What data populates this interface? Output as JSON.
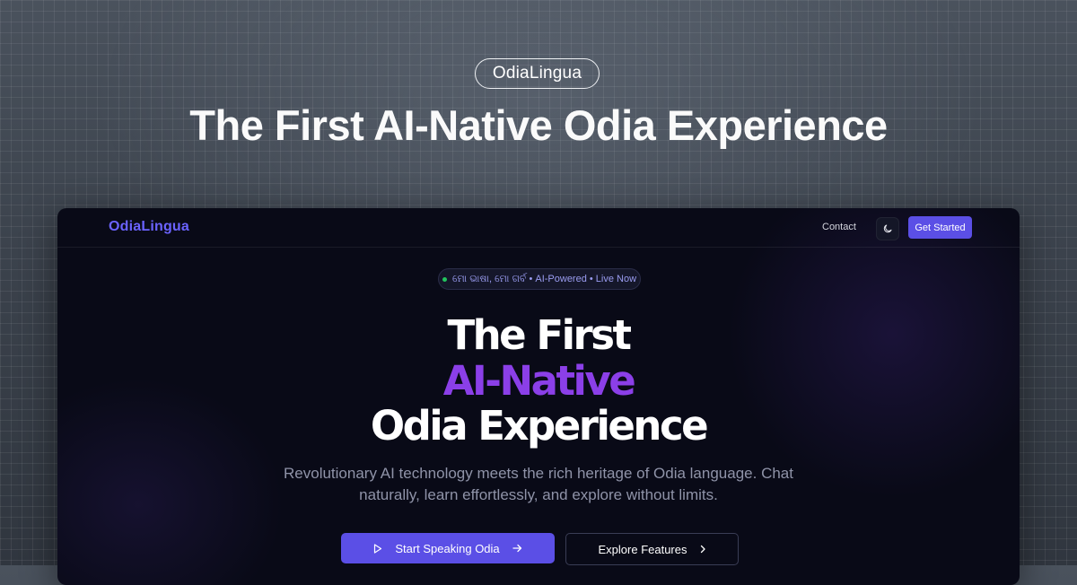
{
  "og": {
    "brand_pill": "OdiaLingua",
    "title": "The First AI-Native Odia Experience"
  },
  "nav": {
    "logo": "OdiaLingua",
    "contact": "Contact",
    "theme_icon": "moon-icon",
    "cta": "Get Started"
  },
  "hero": {
    "badge_text": "ମୋ ଭାଷା, ମୋ ଗର୍ବ • AI-Powered • Live Now",
    "line1": "The First",
    "line2": "AI-Native",
    "line3": "Odia Experience",
    "description": "Revolutionary AI technology meets the rich heritage of Odia language. Chat naturally, learn effortlessly, and explore without limits.",
    "primary_button": "Start Speaking Odia",
    "secondary_button": "Explore Features"
  },
  "colors": {
    "accent": "#5b4fe6",
    "logo": "#6b63ff",
    "highlight": "#8b3fe8",
    "live_dot": "#22c55e"
  }
}
